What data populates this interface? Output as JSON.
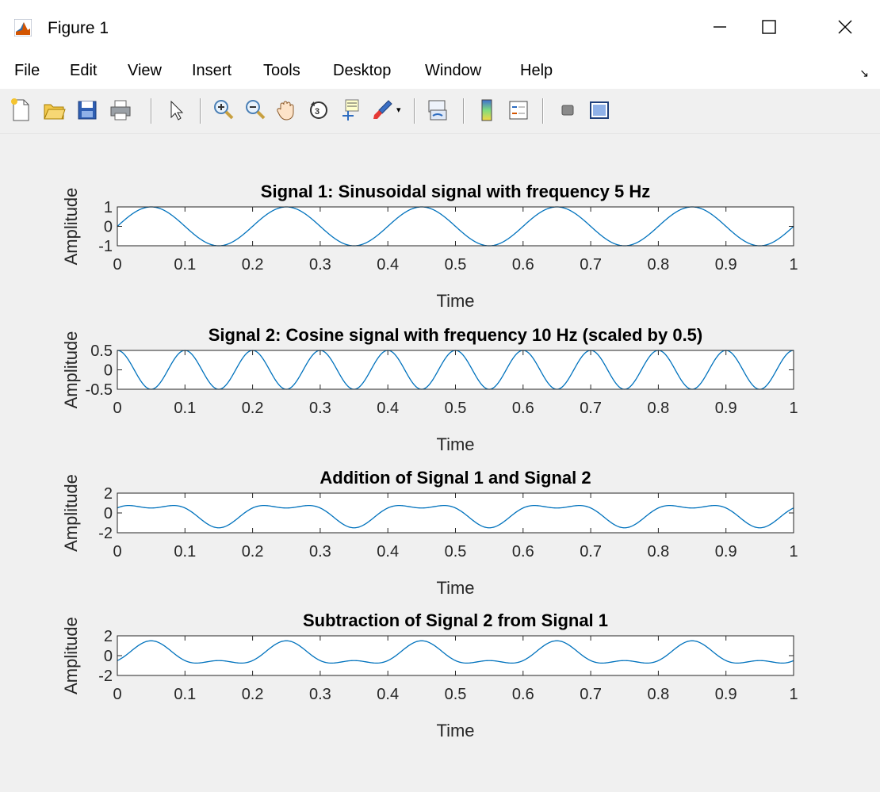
{
  "window": {
    "title": "Figure 1",
    "controls": [
      "minimize",
      "maximize",
      "close"
    ]
  },
  "menu": [
    "File",
    "Edit",
    "View",
    "Insert",
    "Tools",
    "Desktop",
    "Window",
    "Help"
  ],
  "toolbar": {
    "buttons": [
      "new-figure-icon",
      "open-file-icon",
      "save-icon",
      "print-icon",
      "pointer-icon",
      "zoom-in-icon",
      "zoom-out-icon",
      "pan-icon",
      "rotate-3d-icon",
      "data-cursor-icon",
      "brush-icon",
      "link-plot-icon",
      "colorbar-icon",
      "legend-icon",
      "hide-plot-tools-icon",
      "show-plot-tools-icon"
    ]
  },
  "colors": {
    "line": "#0072bd",
    "axes": "#262626",
    "figure_bg": "#f0f0f0"
  },
  "chart_data": [
    {
      "type": "line",
      "title": "Signal 1: Sinusoidal signal with frequency 5 Hz",
      "xlabel": "Time",
      "ylabel": "Amplitude",
      "xlim": [
        0,
        1
      ],
      "ylim": [
        -1,
        1
      ],
      "xticks": [
        "0",
        "0.1",
        "0.2",
        "0.3",
        "0.4",
        "0.5",
        "0.6",
        "0.7",
        "0.8",
        "0.9",
        "1"
      ],
      "yticks": [
        "-1",
        "0",
        "1"
      ],
      "series": [
        {
          "components": [
            {
              "type": "sin",
              "amp": 1,
              "freq": 5
            }
          ]
        }
      ]
    },
    {
      "type": "line",
      "title": "Signal 2: Cosine signal with frequency 10 Hz (scaled by 0.5)",
      "xlabel": "Time",
      "ylabel": "Amplitude",
      "xlim": [
        0,
        1
      ],
      "ylim": [
        -0.5,
        0.5
      ],
      "xticks": [
        "0",
        "0.1",
        "0.2",
        "0.3",
        "0.4",
        "0.5",
        "0.6",
        "0.7",
        "0.8",
        "0.9",
        "1"
      ],
      "yticks": [
        "-0.5",
        "0",
        "0.5"
      ],
      "series": [
        {
          "components": [
            {
              "type": "cos",
              "amp": 0.5,
              "freq": 10
            }
          ]
        }
      ]
    },
    {
      "type": "line",
      "title": "Addition of Signal 1 and Signal 2",
      "xlabel": "Time",
      "ylabel": "Amplitude",
      "xlim": [
        0,
        1
      ],
      "ylim": [
        -2,
        2
      ],
      "xticks": [
        "0",
        "0.1",
        "0.2",
        "0.3",
        "0.4",
        "0.5",
        "0.6",
        "0.7",
        "0.8",
        "0.9",
        "1"
      ],
      "yticks": [
        "-2",
        "0",
        "2"
      ],
      "series": [
        {
          "components": [
            {
              "type": "sin",
              "amp": 1,
              "freq": 5
            },
            {
              "type": "cos",
              "amp": 0.5,
              "freq": 10
            }
          ]
        }
      ]
    },
    {
      "type": "line",
      "title": "Subtraction of Signal 2 from Signal 1",
      "xlabel": "Time",
      "ylabel": "Amplitude",
      "xlim": [
        0,
        1
      ],
      "ylim": [
        -2,
        2
      ],
      "xticks": [
        "0",
        "0.1",
        "0.2",
        "0.3",
        "0.4",
        "0.5",
        "0.6",
        "0.7",
        "0.8",
        "0.9",
        "1"
      ],
      "yticks": [
        "-2",
        "0",
        "2"
      ],
      "series": [
        {
          "components": [
            {
              "type": "sin",
              "amp": 1,
              "freq": 5
            },
            {
              "type": "cos",
              "amp": -0.5,
              "freq": 10
            }
          ]
        }
      ]
    }
  ]
}
